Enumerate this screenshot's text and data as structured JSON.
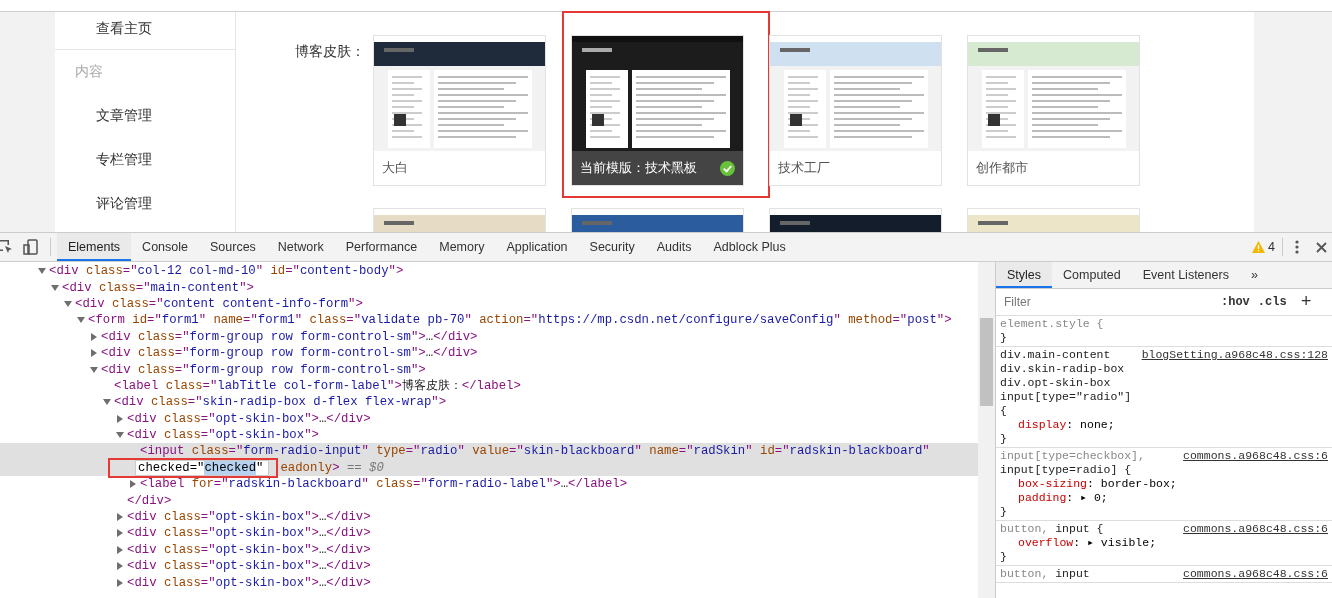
{
  "sidebar": {
    "items": [
      {
        "label": "查看主页",
        "kind": "link"
      },
      {
        "label": "内容",
        "kind": "header"
      },
      {
        "label": "文章管理",
        "kind": "link"
      },
      {
        "label": "专栏管理",
        "kind": "link"
      },
      {
        "label": "评论管理",
        "kind": "link"
      }
    ]
  },
  "skin_field": {
    "label": "博客皮肤：",
    "skins": [
      {
        "name": "大白",
        "selected": false,
        "highlighted": false,
        "color": "#1f2a3a"
      },
      {
        "name": "当前模版：技术黑板",
        "selected": true,
        "highlighted": true,
        "color": "#1c1c1c"
      },
      {
        "name": "技术工厂",
        "selected": false,
        "highlighted": false,
        "color": "#cfe0f0"
      },
      {
        "name": "创作都市",
        "selected": false,
        "highlighted": false,
        "color": "#d6ead2"
      }
    ],
    "more_skins": [
      {
        "color": "#e6dcc6"
      },
      {
        "color": "#2b5d9e"
      },
      {
        "color": "#141d2b"
      },
      {
        "color": "#ece5c8"
      }
    ]
  },
  "devtools": {
    "tabs": [
      {
        "label": "Elements",
        "selected": true
      },
      {
        "label": "Console",
        "selected": false
      },
      {
        "label": "Sources",
        "selected": false
      },
      {
        "label": "Network",
        "selected": false
      },
      {
        "label": "Performance",
        "selected": false
      },
      {
        "label": "Memory",
        "selected": false
      },
      {
        "label": "Application",
        "selected": false
      },
      {
        "label": "Security",
        "selected": false
      },
      {
        "label": "Audits",
        "selected": false
      },
      {
        "label": "Adblock Plus",
        "selected": false
      }
    ],
    "warnings": "4",
    "dom": [
      {
        "selected": false,
        "expanded": true,
        "tokens": [
          {
            "kind": "tag",
            "t": "<div "
          },
          {
            "kind": "attr",
            "t": "class"
          },
          {
            "kind": "tag",
            "t": "=\""
          },
          {
            "kind": "val",
            "t": "col-12 col-md-10"
          },
          {
            "kind": "tag",
            "t": "\" "
          },
          {
            "kind": "attr",
            "t": "id"
          },
          {
            "kind": "tag",
            "t": "=\""
          },
          {
            "kind": "val",
            "t": "content-body"
          },
          {
            "kind": "tag",
            "t": "\">"
          }
        ],
        "children": [
          {
            "selected": false,
            "expanded": true,
            "tokens": [
              {
                "kind": "tag",
                "t": "<div "
              },
              {
                "kind": "attr",
                "t": "class"
              },
              {
                "kind": "tag",
                "t": "=\""
              },
              {
                "kind": "val",
                "t": "main-content"
              },
              {
                "kind": "tag",
                "t": "\">"
              }
            ],
            "children": [
              {
                "selected": false,
                "expanded": true,
                "tokens": [
                  {
                    "kind": "tag",
                    "t": "<div "
                  },
                  {
                    "kind": "attr",
                    "t": "class"
                  },
                  {
                    "kind": "tag",
                    "t": "=\""
                  },
                  {
                    "kind": "val",
                    "t": "content content-info-form"
                  },
                  {
                    "kind": "tag",
                    "t": "\">"
                  }
                ],
                "children": [
                  {
                    "selected": false,
                    "expanded": true,
                    "tokens": [
                      {
                        "kind": "tag",
                        "t": "<form "
                      },
                      {
                        "kind": "attr",
                        "t": "id"
                      },
                      {
                        "kind": "tag",
                        "t": "=\""
                      },
                      {
                        "kind": "val",
                        "t": "form1"
                      },
                      {
                        "kind": "tag",
                        "t": "\" "
                      },
                      {
                        "kind": "attr",
                        "t": "name"
                      },
                      {
                        "kind": "tag",
                        "t": "=\""
                      },
                      {
                        "kind": "val",
                        "t": "form1"
                      },
                      {
                        "kind": "tag",
                        "t": "\" "
                      },
                      {
                        "kind": "attr",
                        "t": "class"
                      },
                      {
                        "kind": "tag",
                        "t": "=\""
                      },
                      {
                        "kind": "val",
                        "t": "validate pb-70"
                      },
                      {
                        "kind": "tag",
                        "t": "\" "
                      },
                      {
                        "kind": "attr",
                        "t": "action"
                      },
                      {
                        "kind": "tag",
                        "t": "=\""
                      },
                      {
                        "kind": "val",
                        "t": "https://mp.csdn.net/configure/saveConfig"
                      },
                      {
                        "kind": "tag",
                        "t": "\" "
                      },
                      {
                        "kind": "attr",
                        "t": "method"
                      },
                      {
                        "kind": "tag",
                        "t": "=\""
                      },
                      {
                        "kind": "val",
                        "t": "post"
                      },
                      {
                        "kind": "tag",
                        "t": "\">"
                      }
                    ],
                    "children": [
                      {
                        "selected": false,
                        "expanded": false,
                        "tokens": [
                          {
                            "kind": "tag",
                            "t": "<div "
                          },
                          {
                            "kind": "attr",
                            "t": "class"
                          },
                          {
                            "kind": "tag",
                            "t": "=\""
                          },
                          {
                            "kind": "val",
                            "t": "form-group row form-control-sm"
                          },
                          {
                            "kind": "tag",
                            "t": "\">"
                          },
                          {
                            "kind": "text",
                            "t": "…"
                          },
                          {
                            "kind": "tag",
                            "t": "</div>"
                          }
                        ]
                      },
                      {
                        "selected": false,
                        "expanded": false,
                        "tokens": [
                          {
                            "kind": "tag",
                            "t": "<div "
                          },
                          {
                            "kind": "attr",
                            "t": "class"
                          },
                          {
                            "kind": "tag",
                            "t": "=\""
                          },
                          {
                            "kind": "val",
                            "t": "form-group row form-control-sm"
                          },
                          {
                            "kind": "tag",
                            "t": "\">"
                          },
                          {
                            "kind": "text",
                            "t": "…"
                          },
                          {
                            "kind": "tag",
                            "t": "</div>"
                          }
                        ]
                      },
                      {
                        "selected": false,
                        "expanded": true,
                        "tokens": [
                          {
                            "kind": "tag",
                            "t": "<div "
                          },
                          {
                            "kind": "attr",
                            "t": "class"
                          },
                          {
                            "kind": "tag",
                            "t": "=\""
                          },
                          {
                            "kind": "val",
                            "t": "form-group row form-control-sm"
                          },
                          {
                            "kind": "tag",
                            "t": "\">"
                          }
                        ],
                        "children": [
                          {
                            "selected": false,
                            "tokens": [
                              {
                                "kind": "tag",
                                "t": "<label "
                              },
                              {
                                "kind": "attr",
                                "t": "class"
                              },
                              {
                                "kind": "tag",
                                "t": "=\""
                              },
                              {
                                "kind": "val",
                                "t": "labTitle col-form-label"
                              },
                              {
                                "kind": "tag",
                                "t": "\">"
                              },
                              {
                                "kind": "text",
                                "t": "博客皮肤："
                              },
                              {
                                "kind": "tag",
                                "t": "</label>"
                              }
                            ]
                          },
                          {
                            "selected": false,
                            "expanded": true,
                            "tokens": [
                              {
                                "kind": "tag",
                                "t": "<div "
                              },
                              {
                                "kind": "attr",
                                "t": "class"
                              },
                              {
                                "kind": "tag",
                                "t": "=\""
                              },
                              {
                                "kind": "val",
                                "t": "skin-radip-box d-flex flex-wrap"
                              },
                              {
                                "kind": "tag",
                                "t": "\">"
                              }
                            ],
                            "children": [
                              {
                                "selected": false,
                                "expanded": false,
                                "tokens": [
                                  {
                                    "kind": "tag",
                                    "t": "<div "
                                  },
                                  {
                                    "kind": "attr",
                                    "t": "class"
                                  },
                                  {
                                    "kind": "tag",
                                    "t": "=\""
                                  },
                                  {
                                    "kind": "val",
                                    "t": "opt-skin-box"
                                  },
                                  {
                                    "kind": "tag",
                                    "t": "\">"
                                  },
                                  {
                                    "kind": "text",
                                    "t": "…"
                                  },
                                  {
                                    "kind": "tag",
                                    "t": "</div>"
                                  }
                                ]
                              },
                              {
                                "selected": false,
                                "expanded": true,
                                "tokens": [
                                  {
                                    "kind": "tag",
                                    "t": "<div "
                                  },
                                  {
                                    "kind": "attr",
                                    "t": "class"
                                  },
                                  {
                                    "kind": "tag",
                                    "t": "=\""
                                  },
                                  {
                                    "kind": "val",
                                    "t": "opt-skin-box"
                                  },
                                  {
                                    "kind": "tag",
                                    "t": "\">"
                                  }
                                ],
                                "close": "</div>",
                                "children": [
                                  {
                                    "selected": true,
                                    "tokens": [
                                      {
                                        "kind": "tag",
                                        "t": "<input "
                                      },
                                      {
                                        "kind": "attr",
                                        "t": "class"
                                      },
                                      {
                                        "kind": "tag",
                                        "t": "=\""
                                      },
                                      {
                                        "kind": "val",
                                        "t": "form-radio-input"
                                      },
                                      {
                                        "kind": "tag",
                                        "t": "\" "
                                      },
                                      {
                                        "kind": "attr",
                                        "t": "type"
                                      },
                                      {
                                        "kind": "tag",
                                        "t": "=\""
                                      },
                                      {
                                        "kind": "val",
                                        "t": "radio"
                                      },
                                      {
                                        "kind": "tag",
                                        "t": "\" "
                                      },
                                      {
                                        "kind": "attr",
                                        "t": "value"
                                      },
                                      {
                                        "kind": "tag",
                                        "t": "=\""
                                      },
                                      {
                                        "kind": "val",
                                        "t": "skin-blackboard"
                                      },
                                      {
                                        "kind": "tag",
                                        "t": "\" "
                                      },
                                      {
                                        "kind": "attr",
                                        "t": "name"
                                      },
                                      {
                                        "kind": "tag",
                                        "t": "=\""
                                      },
                                      {
                                        "kind": "val",
                                        "t": "radSkin"
                                      },
                                      {
                                        "kind": "tag",
                                        "t": "\" "
                                      },
                                      {
                                        "kind": "attr",
                                        "t": "id"
                                      },
                                      {
                                        "kind": "tag",
                                        "t": "=\""
                                      },
                                      {
                                        "kind": "val",
                                        "t": "radskin-blackboard"
                                      },
                                      {
                                        "kind": "tag",
                                        "t": "\""
                                      }
                                    ],
                                    "edit": {
                                      "before": "checked=\"",
                                      "selected_text": "checked",
                                      "after": "\"",
                                      "highlighted": true
                                    },
                                    "rest": [
                                      {
                                        "kind": "attr",
                                        "t": "eadonly"
                                      },
                                      {
                                        "kind": "tag",
                                        "t": ">"
                                      },
                                      {
                                        "kind": "dim",
                                        "t": " == $0"
                                      }
                                    ]
                                  },
                                  {
                                    "selected": false,
                                    "expanded": false,
                                    "tokens": [
                                      {
                                        "kind": "tag",
                                        "t": "<label "
                                      },
                                      {
                                        "kind": "attr",
                                        "t": "for"
                                      },
                                      {
                                        "kind": "tag",
                                        "t": "=\""
                                      },
                                      {
                                        "kind": "val",
                                        "t": "radskin-blackboard"
                                      },
                                      {
                                        "kind": "tag",
                                        "t": "\" "
                                      },
                                      {
                                        "kind": "attr",
                                        "t": "class"
                                      },
                                      {
                                        "kind": "tag",
                                        "t": "=\""
                                      },
                                      {
                                        "kind": "val",
                                        "t": "form-radio-label"
                                      },
                                      {
                                        "kind": "tag",
                                        "t": "\">"
                                      },
                                      {
                                        "kind": "text",
                                        "t": "…"
                                      },
                                      {
                                        "kind": "tag",
                                        "t": "</label>"
                                      }
                                    ]
                                  }
                                ]
                              },
                              {
                                "selected": false,
                                "expanded": false,
                                "tokens": [
                                  {
                                    "kind": "tag",
                                    "t": "<div "
                                  },
                                  {
                                    "kind": "attr",
                                    "t": "class"
                                  },
                                  {
                                    "kind": "tag",
                                    "t": "=\""
                                  },
                                  {
                                    "kind": "val",
                                    "t": "opt-skin-box"
                                  },
                                  {
                                    "kind": "tag",
                                    "t": "\">"
                                  },
                                  {
                                    "kind": "text",
                                    "t": "…"
                                  },
                                  {
                                    "kind": "tag",
                                    "t": "</div>"
                                  }
                                ]
                              },
                              {
                                "selected": false,
                                "expanded": false,
                                "tokens": [
                                  {
                                    "kind": "tag",
                                    "t": "<div "
                                  },
                                  {
                                    "kind": "attr",
                                    "t": "class"
                                  },
                                  {
                                    "kind": "tag",
                                    "t": "=\""
                                  },
                                  {
                                    "kind": "val",
                                    "t": "opt-skin-box"
                                  },
                                  {
                                    "kind": "tag",
                                    "t": "\">"
                                  },
                                  {
                                    "kind": "text",
                                    "t": "…"
                                  },
                                  {
                                    "kind": "tag",
                                    "t": "</div>"
                                  }
                                ]
                              },
                              {
                                "selected": false,
                                "expanded": false,
                                "tokens": [
                                  {
                                    "kind": "tag",
                                    "t": "<div "
                                  },
                                  {
                                    "kind": "attr",
                                    "t": "class"
                                  },
                                  {
                                    "kind": "tag",
                                    "t": "=\""
                                  },
                                  {
                                    "kind": "val",
                                    "t": "opt-skin-box"
                                  },
                                  {
                                    "kind": "tag",
                                    "t": "\">"
                                  },
                                  {
                                    "kind": "text",
                                    "t": "…"
                                  },
                                  {
                                    "kind": "tag",
                                    "t": "</div>"
                                  }
                                ]
                              },
                              {
                                "selected": false,
                                "expanded": false,
                                "tokens": [
                                  {
                                    "kind": "tag",
                                    "t": "<div "
                                  },
                                  {
                                    "kind": "attr",
                                    "t": "class"
                                  },
                                  {
                                    "kind": "tag",
                                    "t": "=\""
                                  },
                                  {
                                    "kind": "val",
                                    "t": "opt-skin-box"
                                  },
                                  {
                                    "kind": "tag",
                                    "t": "\">"
                                  },
                                  {
                                    "kind": "text",
                                    "t": "…"
                                  },
                                  {
                                    "kind": "tag",
                                    "t": "</div>"
                                  }
                                ]
                              },
                              {
                                "selected": false,
                                "expanded": false,
                                "tokens": [
                                  {
                                    "kind": "tag",
                                    "t": "<div "
                                  },
                                  {
                                    "kind": "attr",
                                    "t": "class"
                                  },
                                  {
                                    "kind": "tag",
                                    "t": "=\""
                                  },
                                  {
                                    "kind": "val",
                                    "t": "opt-skin-box"
                                  },
                                  {
                                    "kind": "tag",
                                    "t": "\">"
                                  },
                                  {
                                    "kind": "text",
                                    "t": "…"
                                  },
                                  {
                                    "kind": "tag",
                                    "t": "</div>"
                                  }
                                ]
                              }
                            ]
                          }
                        ]
                      }
                    ]
                  }
                ]
              }
            ]
          }
        ]
      }
    ],
    "style_tabs": [
      {
        "label": "Styles",
        "selected": true
      },
      {
        "label": "Computed",
        "selected": false
      },
      {
        "label": "Event Listeners",
        "selected": false
      }
    ],
    "more_tabs": "»",
    "filter": {
      "placeholder": "Filter"
    },
    "hov": ":hov",
    "cls": ".cls",
    "add": "+",
    "rules": [
      {
        "selector": [
          {
            "text": "element.style {",
            "matched": false
          }
        ],
        "close": "}"
      },
      {
        "selector": [
          {
            "text": "div.main-content div.skin-radip-box div.opt-skin-box input[type=\"radio\"] {",
            "matched": true
          }
        ],
        "source": "blogSetting.a968c48.css:128",
        "props": [
          {
            "name": "display",
            "sep": ":",
            "value": " none;"
          }
        ],
        "close": "}"
      },
      {
        "selector": [
          {
            "text": "input[type=checkbox],",
            "matched": false
          },
          {
            "text": "input[type=radio] {",
            "matched": true
          }
        ],
        "source": "commons.a968c48.css:6",
        "props": [
          {
            "name": "box-sizing",
            "sep": ":",
            "value": " border-box;"
          },
          {
            "name": "padding",
            "sep": ":",
            "toggle": "▸",
            "value": "0;"
          }
        ],
        "close": "}"
      },
      {
        "selector": [
          {
            "text": "button,",
            "matched": false
          },
          {
            "text": "input {",
            "matched": true
          }
        ],
        "source": "commons.a968c48.css:6",
        "props": [
          {
            "name": "overflow",
            "sep": ":",
            "toggle": "▸",
            "value": "visible;"
          }
        ],
        "close": "}"
      },
      {
        "selector": [
          {
            "text": "button,",
            "matched": false
          },
          {
            "text": "input",
            "matched": true
          }
        ],
        "source": "commons.a968c48.css:6"
      }
    ]
  }
}
